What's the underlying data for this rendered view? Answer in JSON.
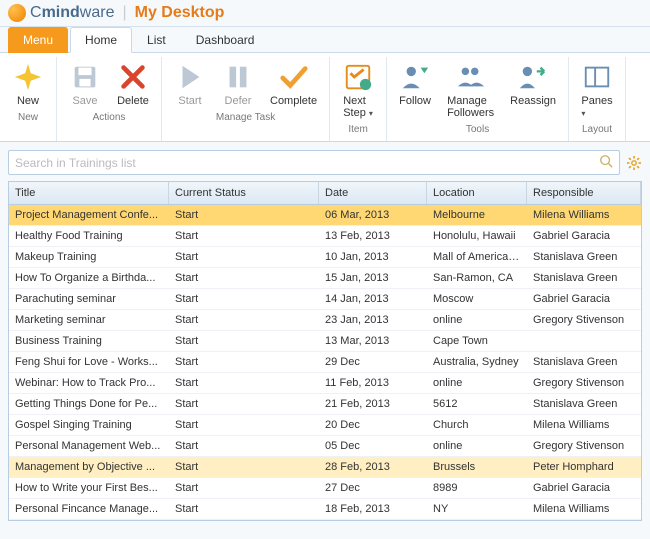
{
  "header": {
    "brand_prefix": "C",
    "brand_mid": "mind",
    "brand_suffix": "ware",
    "workspace": "My Desktop"
  },
  "tabs": {
    "menu": "Menu",
    "items": [
      "Home",
      "List",
      "Dashboard"
    ],
    "active": "Home"
  },
  "ribbon": {
    "groups": [
      {
        "label": "New",
        "buttons": [
          {
            "name": "new-button",
            "label": "New",
            "icon": "sparkle-icon",
            "enabled": true
          }
        ]
      },
      {
        "label": "Actions",
        "buttons": [
          {
            "name": "save-button",
            "label": "Save",
            "icon": "save-icon",
            "enabled": false
          },
          {
            "name": "delete-button",
            "label": "Delete",
            "icon": "delete-icon",
            "enabled": true
          }
        ]
      },
      {
        "label": "Manage Task",
        "buttons": [
          {
            "name": "start-button",
            "label": "Start",
            "icon": "play-icon",
            "enabled": false
          },
          {
            "name": "defer-button",
            "label": "Defer",
            "icon": "pause-icon",
            "enabled": false
          },
          {
            "name": "complete-button",
            "label": "Complete",
            "icon": "check-icon",
            "enabled": true
          }
        ]
      },
      {
        "label": "Item",
        "buttons": [
          {
            "name": "next-step-button",
            "label": "Next Step",
            "icon": "checklist-icon",
            "enabled": true,
            "dropdown": true
          }
        ]
      },
      {
        "label": "Tools",
        "buttons": [
          {
            "name": "follow-button",
            "label": "Follow",
            "icon": "follow-icon",
            "enabled": true
          },
          {
            "name": "manage-followers-button",
            "label": "Manage Followers",
            "icon": "followers-icon",
            "enabled": true
          },
          {
            "name": "reassign-button",
            "label": "Reassign",
            "icon": "reassign-icon",
            "enabled": true
          }
        ]
      },
      {
        "label": "Layout",
        "buttons": [
          {
            "name": "panes-button",
            "label": "Panes",
            "icon": "panes-icon",
            "enabled": true,
            "dropdown": true
          }
        ]
      }
    ]
  },
  "search": {
    "placeholder": "Search in Trainings list"
  },
  "grid": {
    "columns": [
      "Title",
      "Current Status",
      "Date",
      "Location",
      "Responsible"
    ],
    "rows": [
      {
        "title": "Project Management Confe...",
        "status": "Start",
        "date": "06 Mar, 2013",
        "location": "Melbourne",
        "responsible": "Milena Williams",
        "state": "selected"
      },
      {
        "title": "Healthy Food Training",
        "status": "Start",
        "date": "13 Feb, 2013",
        "location": "Honolulu, Hawaii",
        "responsible": "Gabriel Garacia"
      },
      {
        "title": "Makeup Training",
        "status": "Start",
        "date": "10 Jan, 2013",
        "location": "Mall of America, ...",
        "responsible": "Stanislava Green"
      },
      {
        "title": "How To Organize a Birthda...",
        "status": "Start",
        "date": "15 Jan, 2013",
        "location": "San-Ramon, CA",
        "responsible": "Stanislava Green"
      },
      {
        "title": "Parachuting seminar",
        "status": "Start",
        "date": "14 Jan, 2013",
        "location": "Moscow",
        "responsible": "Gabriel Garacia"
      },
      {
        "title": "Marketing seminar",
        "status": "Start",
        "date": "23 Jan, 2013",
        "location": "online",
        "responsible": "Gregory Stivenson"
      },
      {
        "title": "Business Training",
        "status": "Start",
        "date": "13 Mar, 2013",
        "location": "Cape Town",
        "responsible": ""
      },
      {
        "title": "Feng Shui for Love - Works...",
        "status": "Start",
        "date": "29 Dec",
        "location": "Australia, Sydney",
        "responsible": "Stanislava Green"
      },
      {
        "title": "Webinar: How to Track Pro...",
        "status": "Start",
        "date": "11 Feb, 2013",
        "location": "online",
        "responsible": "Gregory Stivenson"
      },
      {
        "title": "Getting Things Done for Pe...",
        "status": "Start",
        "date": "21 Feb, 2013",
        "location": "5612",
        "responsible": "Stanislava Green"
      },
      {
        "title": "Gospel Singing Training",
        "status": "Start",
        "date": "20 Dec",
        "location": "Church",
        "responsible": "Milena Williams"
      },
      {
        "title": "Personal Management Web...",
        "status": "Start",
        "date": "05 Dec",
        "location": "online",
        "responsible": "Gregory Stivenson"
      },
      {
        "title": "Management by Objective ...",
        "status": "Start",
        "date": "28 Feb, 2013",
        "location": "Brussels",
        "responsible": "Peter Homphard",
        "state": "highlighted"
      },
      {
        "title": "How to Write your First Bes...",
        "status": "Start",
        "date": "27 Dec",
        "location": "8989",
        "responsible": "Gabriel Garacia"
      },
      {
        "title": "Personal Fincance Manage...",
        "status": "Start",
        "date": "18 Feb, 2013",
        "location": "NY",
        "responsible": "Milena Williams"
      }
    ]
  },
  "icons": {
    "sparkle-icon": "#f5c433",
    "save-icon": "#6a8db3",
    "delete-icon": "#d9442c",
    "play-icon": "#9fbfd9",
    "pause-icon": "#9fbfd9",
    "check-icon": "#f0a030",
    "checklist-icon": "#e68a1a",
    "follow-icon": "#6a8db3",
    "followers-icon": "#6a8db3",
    "reassign-icon": "#6a8db3",
    "panes-icon": "#6a8db3"
  }
}
